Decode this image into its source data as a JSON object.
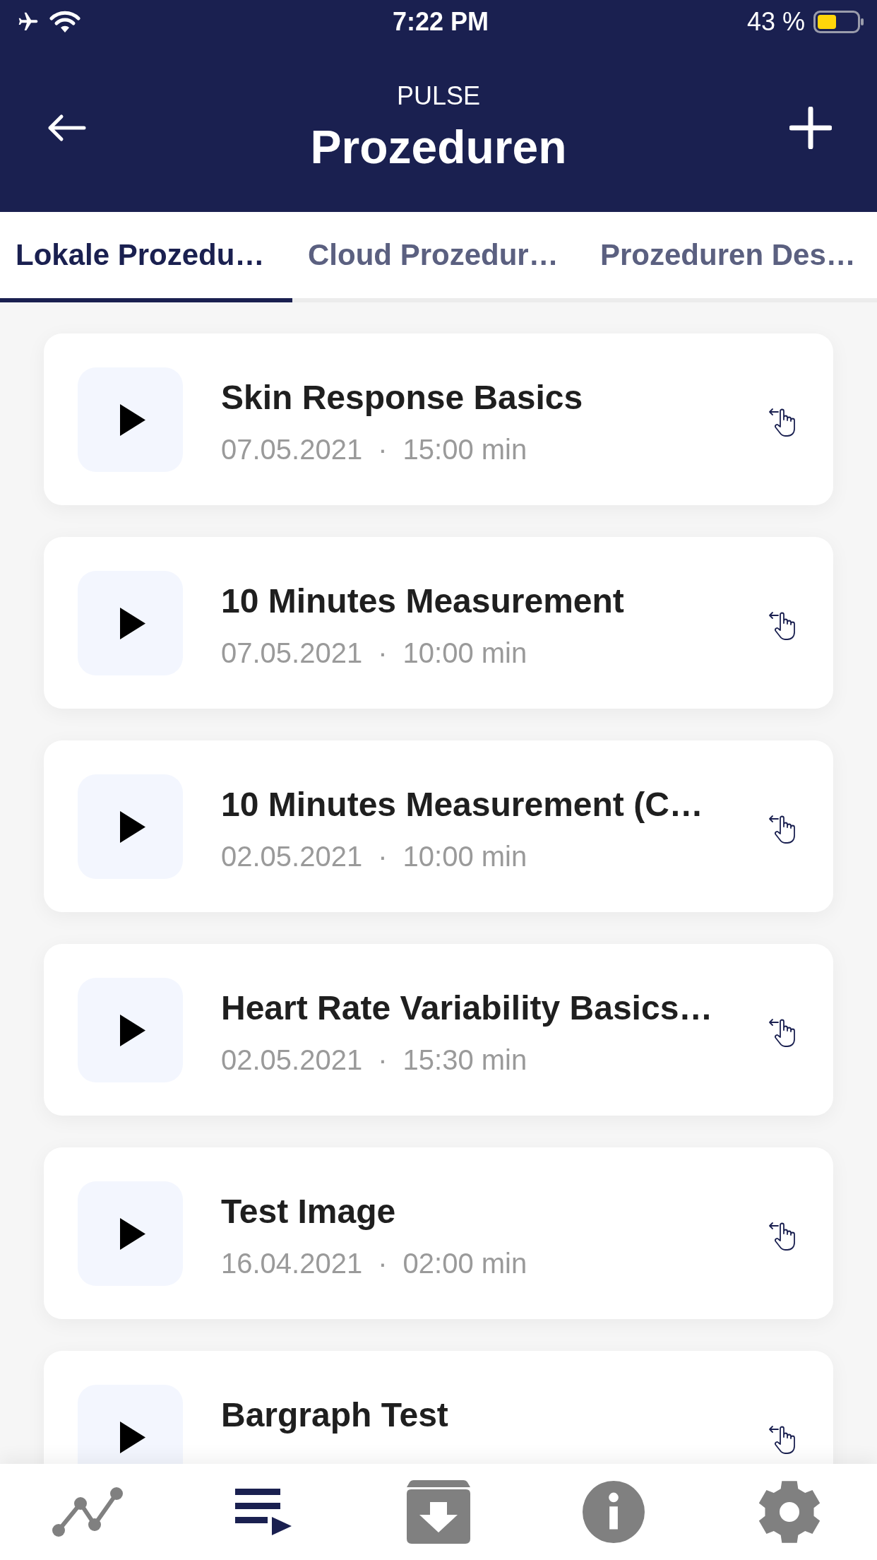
{
  "status_bar": {
    "time": "7:22 PM",
    "battery": "43 %"
  },
  "header": {
    "app_name": "PULSE",
    "title": "Prozeduren"
  },
  "tabs": [
    {
      "label": "Lokale Prozedu…",
      "selected": true
    },
    {
      "label": "Cloud Prozedur…",
      "selected": false
    },
    {
      "label": "Prozeduren Des…",
      "selected": false
    }
  ],
  "procedures": [
    {
      "title": "Skin Response Basics",
      "date": "07.05.2021",
      "separator": "·",
      "duration": "15:00 min"
    },
    {
      "title": "10 Minutes Measurement",
      "date": "07.05.2021",
      "separator": "·",
      "duration": "10:00 min"
    },
    {
      "title": "10 Minutes Measurement (C…",
      "date": "02.05.2021",
      "separator": "·",
      "duration": "10:00 min"
    },
    {
      "title": "Heart Rate Variability Basics…",
      "date": "02.05.2021",
      "separator": "·",
      "duration": "15:30 min"
    },
    {
      "title": "Test Image",
      "date": "16.04.2021",
      "separator": "·",
      "duration": "02:00 min"
    },
    {
      "title": "Bargraph Test"
    }
  ],
  "bottom_nav": [
    {
      "selected": false
    },
    {
      "selected": true
    },
    {
      "selected": false
    },
    {
      "selected": false
    },
    {
      "selected": false
    }
  ]
}
